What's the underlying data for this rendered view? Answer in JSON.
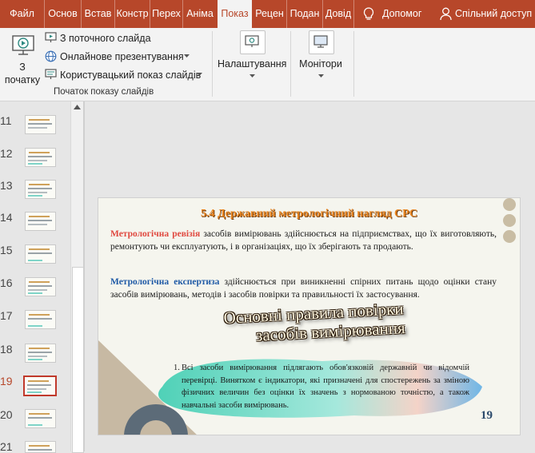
{
  "tabs": [
    "Файл",
    "Основ",
    "Встав",
    "Констр",
    "Перех",
    "Аніма",
    "Показ",
    "Рецен",
    "Подан",
    "Довід"
  ],
  "search_label": "Допомог",
  "share_label": "Спільний доступ",
  "ribbon": {
    "from_start_label": "З початку",
    "from_current_label": "З поточного слайда",
    "online_label": "Онлайнове презентування",
    "custom_label": "Користувацький показ слайдів",
    "group_label": "Початок показу слайдів",
    "setup_label": "Налаштування",
    "monitors_label": "Монітори"
  },
  "slide_numbers": [
    "11",
    "12",
    "13",
    "14",
    "15",
    "16",
    "17",
    "18",
    "19",
    "20",
    "21"
  ],
  "selected_slide": "19",
  "slide": {
    "title": "5.4 Державний метрологічний нагляд СРС",
    "p1_term_a": "Метрологічна",
    "p1_term_b": "ревізія",
    "p1_text": "засобів вимірювань здійснюється на підприємствах, що їх виготовляють, ремонтують чи експлуатують, і в організаціях, що їх зберігають та продають.",
    "p2_term": "Метрологічна експертиза",
    "p2_text": "здійснюється при виникненні спірних питань щодо оцінки стану засобів вимірювань, методів і засобів повірки та правильності їх застосування.",
    "wordart_line1": "Основні правила повірки",
    "wordart_line2": "засобів вимірювання",
    "list_marker": "1.",
    "list_text": "Всі засоби вимірювання підлягають обов'язковій державній чи відомчій перевірці. Винятком є індикатори, які призначені для спостережень за зміною фізичних величин без оцінки їх значень з нормованою точністю, а також навчальні засоби вимірювань.",
    "page_number": "19"
  },
  "colors": {
    "accent": "#b7472a",
    "term_red": "#e0483f",
    "term_blue": "#1f5aa6",
    "title_orange": "#e8841f"
  }
}
